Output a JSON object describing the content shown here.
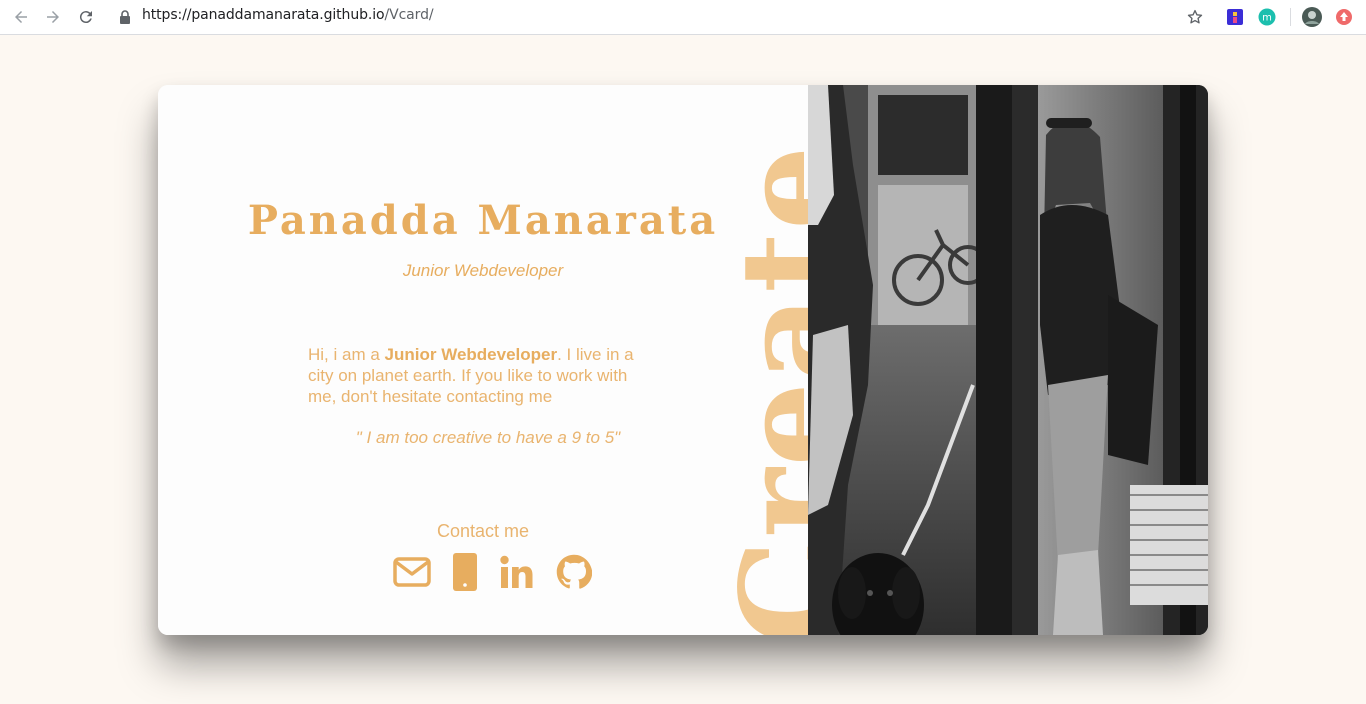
{
  "browser": {
    "url_host": "https://panaddamanarata.github.io",
    "url_path": "/Vcard/",
    "icons": [
      "back-arrow-icon",
      "forward-arrow-icon",
      "reload-icon",
      "lock-icon",
      "star-icon",
      "extension-icon",
      "extension-m-icon",
      "profile-avatar",
      "extension-red-icon"
    ]
  },
  "card": {
    "name": "Panadda Manarata",
    "role": "Junior Webdeveloper",
    "bio_prefix": "Hi, i am a ",
    "bio_highlight": "Junior Webdeveloper",
    "bio_suffix": ". I live in a city on planet earth. If you like to work with me, don't hesitate contacting me",
    "quote": "\" I am too creative to have a 9 to 5\"",
    "contact_label": "Contact me",
    "decor_word": "Create",
    "social_icons": [
      "envelope-icon",
      "phone-icon",
      "linkedin-icon",
      "github-icon"
    ]
  },
  "colors": {
    "accent": "#e7ad5f",
    "decor": "#f1c890",
    "page_background": "#fdf8f2",
    "card_background": "#fdfdfd"
  }
}
